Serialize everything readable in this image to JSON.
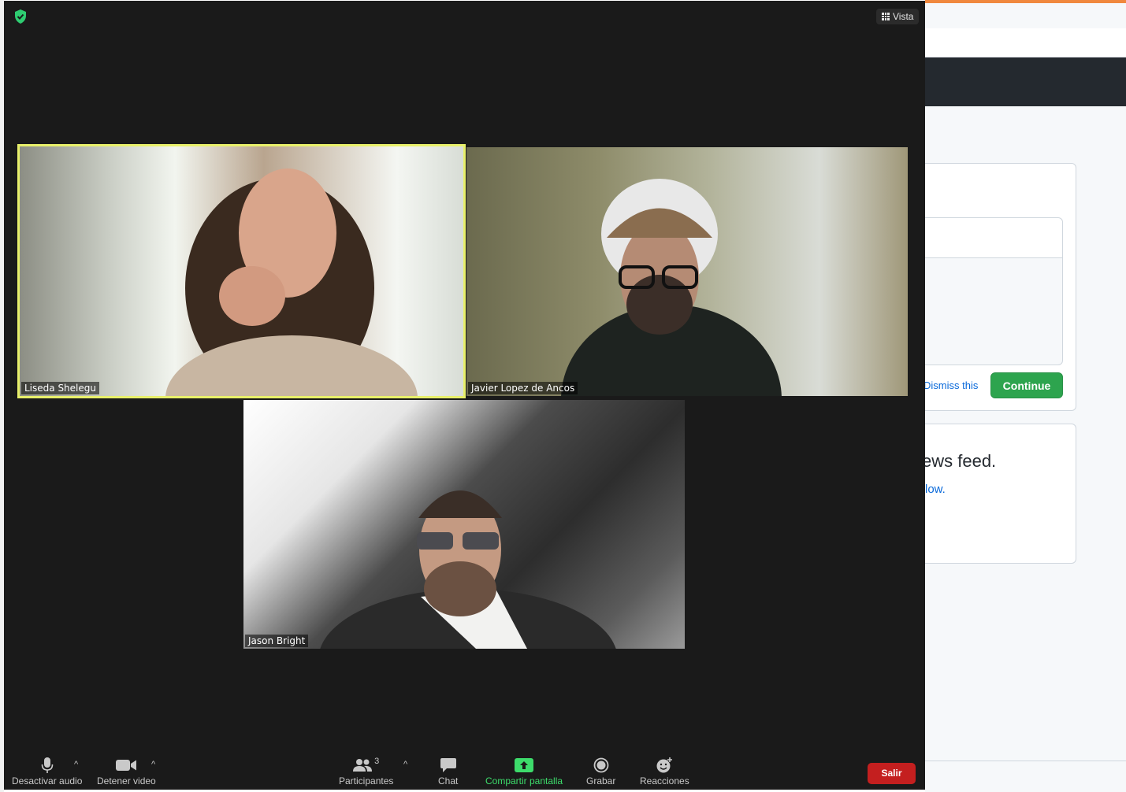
{
  "zoom": {
    "view_label": "Vista",
    "participants": [
      {
        "name": "Liseda Shelegu",
        "active_speaker": true
      },
      {
        "name": "Javier Lopez de Ancos",
        "active_speaker": false
      },
      {
        "name": "Jason Bright",
        "active_speaker": false
      }
    ],
    "toolbar": {
      "mute_label": "Desactivar audio",
      "video_label": "Detener video",
      "participants_label": "Participantes",
      "participants_count": "3",
      "chat_label": "Chat",
      "share_label": "Compartir pantalla",
      "record_label": "Grabar",
      "reactions_label": "Reacciones",
      "leave_label": "Salir"
    },
    "colors": {
      "active_speaker_border": "#e8f06a",
      "share_green": "#3ddc6b",
      "leave_red": "#c41f1f",
      "shield_green": "#2ecc71"
    }
  },
  "background_page": {
    "dismiss_label": "Dismiss this",
    "continue_label": "Continue",
    "news_feed_text": "ews feed.",
    "follow_text": "low."
  }
}
